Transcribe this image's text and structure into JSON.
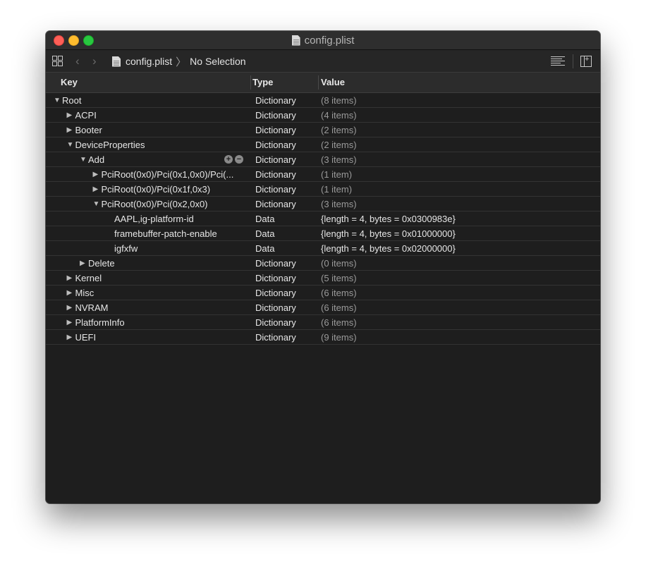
{
  "window": {
    "title": "config.plist"
  },
  "toolbar": {
    "breadcrumb_file": "config.plist",
    "breadcrumb_separator": "〉",
    "breadcrumb_selection": "No Selection"
  },
  "columns": {
    "key": "Key",
    "type": "Type",
    "value": "Value"
  },
  "rows": [
    {
      "key": "Root",
      "type": "Dictionary",
      "value": "(8 items)",
      "level": 0,
      "disc": "open",
      "dim": true
    },
    {
      "key": "ACPI",
      "type": "Dictionary",
      "value": "(4 items)",
      "level": 1,
      "disc": "closed",
      "dim": true
    },
    {
      "key": "Booter",
      "type": "Dictionary",
      "value": "(2 items)",
      "level": 1,
      "disc": "closed",
      "dim": true
    },
    {
      "key": "DeviceProperties",
      "type": "Dictionary",
      "value": "(2 items)",
      "level": 1,
      "disc": "open",
      "dim": true
    },
    {
      "key": "Add",
      "type": "Dictionary",
      "value": "(3 items)",
      "level": 2,
      "disc": "open",
      "dim": true,
      "controls": true
    },
    {
      "key": "PciRoot(0x0)/Pci(0x1,0x0)/Pci(...",
      "type": "Dictionary",
      "value": "(1 item)",
      "level": 3,
      "disc": "closed",
      "dim": true
    },
    {
      "key": "PciRoot(0x0)/Pci(0x1f,0x3)",
      "type": "Dictionary",
      "value": "(1 item)",
      "level": 3,
      "disc": "closed",
      "dim": true
    },
    {
      "key": "PciRoot(0x0)/Pci(0x2,0x0)",
      "type": "Dictionary",
      "value": "(3 items)",
      "level": 3,
      "disc": "open",
      "dim": true
    },
    {
      "key": "AAPL,ig-platform-id",
      "type": "Data",
      "value": "{length = 4, bytes = 0x0300983e}",
      "level": 4,
      "disc": "none",
      "dim": false
    },
    {
      "key": "framebuffer-patch-enable",
      "type": "Data",
      "value": "{length = 4, bytes = 0x01000000}",
      "level": 4,
      "disc": "none",
      "dim": false
    },
    {
      "key": "igfxfw",
      "type": "Data",
      "value": "{length = 4, bytes = 0x02000000}",
      "level": 4,
      "disc": "none",
      "dim": false
    },
    {
      "key": "Delete",
      "type": "Dictionary",
      "value": "(0 items)",
      "level": 2,
      "disc": "closed",
      "dim": true
    },
    {
      "key": "Kernel",
      "type": "Dictionary",
      "value": "(5 items)",
      "level": 1,
      "disc": "closed",
      "dim": true
    },
    {
      "key": "Misc",
      "type": "Dictionary",
      "value": "(6 items)",
      "level": 1,
      "disc": "closed",
      "dim": true
    },
    {
      "key": "NVRAM",
      "type": "Dictionary",
      "value": "(6 items)",
      "level": 1,
      "disc": "closed",
      "dim": true
    },
    {
      "key": "PlatformInfo",
      "type": "Dictionary",
      "value": "(6 items)",
      "level": 1,
      "disc": "closed",
      "dim": true
    },
    {
      "key": "UEFI",
      "type": "Dictionary",
      "value": "(9 items)",
      "level": 1,
      "disc": "closed",
      "dim": true
    }
  ],
  "icons": {
    "close": "close-button",
    "minimize": "minimize-button",
    "zoom": "zoom-button",
    "grid": "grid-icon",
    "back": "back-icon",
    "forward": "forward-icon",
    "document": "document-icon",
    "text-align": "text-align-icon",
    "inspector": "inspector-icon",
    "disclosure-open": "▼",
    "disclosure-closed": "▶",
    "add": "+",
    "remove": "−"
  }
}
